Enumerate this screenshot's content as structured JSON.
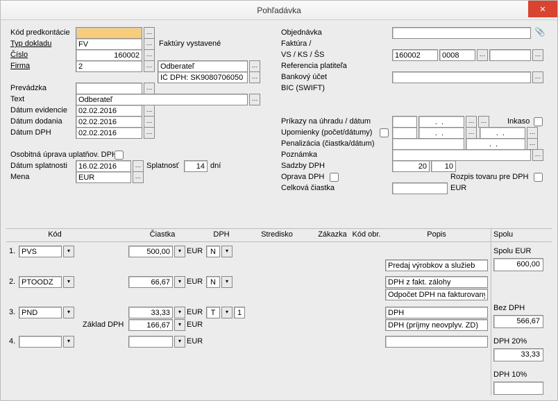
{
  "window": {
    "title": "Pohľadávka"
  },
  "left": {
    "kod_predkontacie_label": "Kód predkontácie",
    "typ_dokladu_label": "Typ dokladu",
    "typ_dokladu": "FV",
    "typ_dokladu_desc": "Faktúry vystavené",
    "cislo_label": "Číslo",
    "cislo": "160002",
    "firma_label": "Firma",
    "firma": "2",
    "firma_desc": "Odberateľ",
    "icdph": "IČ DPH: SK9080706050",
    "prevadzka_label": "Prevádzka",
    "text_label": "Text",
    "text": "Odberateľ",
    "datum_evidencie_label": "Dátum evidencie",
    "datum_evidencie": "02.02.2016",
    "datum_dodania_label": "Dátum dodania",
    "datum_dodania": "02.02.2016",
    "datum_dph_label": "Dátum DPH",
    "datum_dph": "02.02.2016",
    "osobitna_label": "Osobitná úprava uplatňov. DPH",
    "datum_splatnosti_label": "Dátum splatnosti",
    "datum_splatnosti": "16.02.2016",
    "splatnost_label": "Splatnosť",
    "splatnost_dni": "14",
    "dni_label": "dní",
    "mena_label": "Mena",
    "mena": "EUR"
  },
  "right": {
    "objednavka_label": "Objednávka",
    "faktura_label": "Faktúra /",
    "vsksss_label": "VS / KS / ŠS",
    "vs": "160002",
    "ks": "0008",
    "referencia_label": "Referencia platiteľa",
    "bankovy_ucet_label": "Bankový účet",
    "bic_label": "BIC (SWIFT)",
    "prikazy_label": "Príkazy na úhradu / dátum",
    "inkaso_label": "Inkaso",
    "upomienky_label": "Upomienky (počet/dátumy)",
    "penalizacia_label": "Penalizácia (čiastka/dátum)",
    "poznamka_label": "Poznámka",
    "sadzby_label": "Sadzby DPH",
    "sadzba1": "20",
    "sadzba2": "10",
    "oprava_label": "Oprava DPH",
    "rozpis_label": "Rozpis tovaru pre DPH",
    "celkova_label": "Celková čiastka",
    "celkova_currency": "EUR",
    "date_placeholder": "  .  .    "
  },
  "grid": {
    "headers": {
      "kod": "Kód",
      "ciastka": "Čiastka",
      "dph": "DPH",
      "stredisko": "Stredisko",
      "zakazka": "Zákazka",
      "kodobr": "Kód obr.",
      "popis": "Popis",
      "spolu": "Spolu"
    },
    "rows": [
      {
        "num": "1.",
        "kod": "PVS",
        "ciastka": "500,00",
        "currency": "EUR",
        "dph": "N",
        "popis": "Predaj výrobkov a služieb"
      },
      {
        "num": "2.",
        "kod": "PTOODZ",
        "ciastka": "66,67",
        "currency": "EUR",
        "dph": "N",
        "popis": "DPH z fakt. zálohy",
        "popis2": "Odpočet DPH na fakturovaných"
      },
      {
        "num": "3.",
        "kod": "PND",
        "ciastka": "33,33",
        "currency": "EUR",
        "dph": "T",
        "dph_extra": "1",
        "popis": "DPH"
      },
      {
        "num": "4.",
        "kod": "",
        "ciastka": "",
        "currency": "EUR",
        "dph": "",
        "popis": ""
      }
    ],
    "zaklad_label": "Základ DPH",
    "zaklad_ciastka": "166,67",
    "zaklad_currency": "EUR",
    "zaklad_popis": "DPH (príjmy neovplyv. ZD)"
  },
  "totals": {
    "spolu_eur_label": "Spolu EUR",
    "spolu_eur": "600,00",
    "bez_dph_label": "Bez DPH",
    "bez_dph": "566,67",
    "dph20_label": "DPH 20%",
    "dph20": "33,33",
    "dph10_label": "DPH 10%"
  }
}
